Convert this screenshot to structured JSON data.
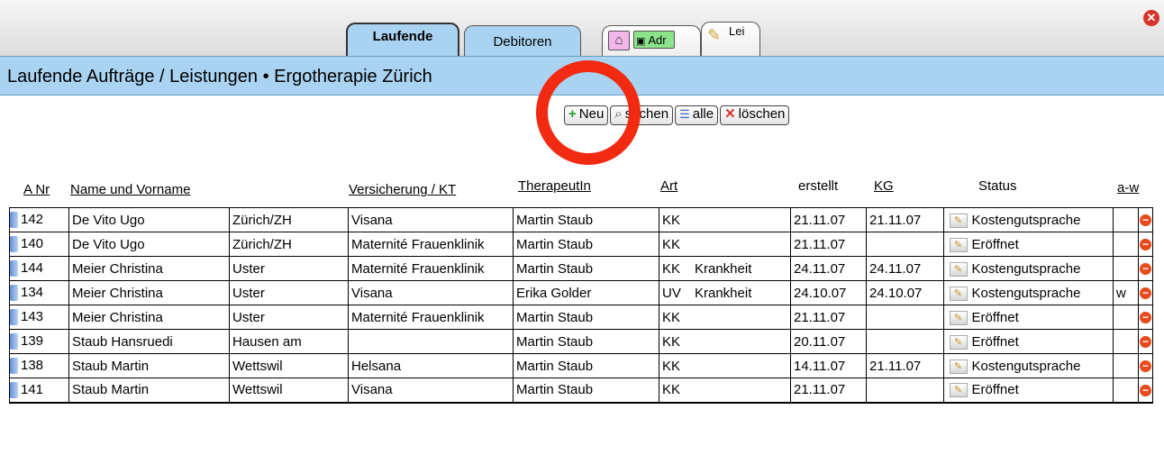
{
  "tabs": {
    "laufende": "Laufende",
    "debitoren": "Debitoren",
    "adr": "Adr",
    "lei": "Lei"
  },
  "title": "Laufende Aufträge / Leistungen • Ergotherapie Zürich",
  "buttons": {
    "neu": "Neu",
    "suchen": "suchen",
    "alle": "alle",
    "loeschen": "löschen"
  },
  "columns": {
    "a_nr": "A Nr",
    "name": "Name und Vorname",
    "versicherung": "Versicherung / KT",
    "therapeut": "TherapeutIn",
    "art": "Art",
    "erstellt": "erstellt",
    "kg": "KG",
    "status": "Status",
    "aw": "a-w"
  },
  "rows": [
    {
      "nr": "142",
      "name": "De Vito Ugo",
      "ort": "Zürich/ZH",
      "vers": "Visana",
      "ther": "Martin Staub",
      "art": "KK",
      "grund": "",
      "erstellt": "21.11.07",
      "kg": "21.11.07",
      "status": "Kostengutsprache",
      "aw": ""
    },
    {
      "nr": "140",
      "name": "De Vito Ugo",
      "ort": "Zürich/ZH",
      "vers": "Maternité Frauenklinik",
      "ther": "Martin Staub",
      "art": "KK",
      "grund": "",
      "erstellt": "21.11.07",
      "kg": "",
      "status": "Eröffnet",
      "aw": ""
    },
    {
      "nr": "144",
      "name": "Meier Christina",
      "ort": "Uster",
      "vers": "Maternité Frauenklinik",
      "ther": "Martin Staub",
      "art": "KK",
      "grund": "Krankheit",
      "erstellt": "24.11.07",
      "kg": "24.11.07",
      "status": "Kostengutsprache",
      "aw": ""
    },
    {
      "nr": "134",
      "name": "Meier Christina",
      "ort": "Uster",
      "vers": "Visana",
      "ther": "Erika Golder",
      "art": "UV",
      "grund": "Krankheit",
      "erstellt": "24.10.07",
      "kg": "24.10.07",
      "status": "Kostengutsprache",
      "aw": "w"
    },
    {
      "nr": "143",
      "name": "Meier Christina",
      "ort": "Uster",
      "vers": "Maternité Frauenklinik",
      "ther": "Martin Staub",
      "art": "KK",
      "grund": "",
      "erstellt": "21.11.07",
      "kg": "",
      "status": "Eröffnet",
      "aw": ""
    },
    {
      "nr": "139",
      "name": "Staub Hansruedi",
      "ort": "Hausen am",
      "vers": "",
      "ther": "Martin Staub",
      "art": "KK",
      "grund": "",
      "erstellt": "20.11.07",
      "kg": "",
      "status": "Eröffnet",
      "aw": ""
    },
    {
      "nr": "138",
      "name": "Staub Martin",
      "ort": "Wettswil",
      "vers": "Helsana",
      "ther": "Martin Staub",
      "art": "KK",
      "grund": "",
      "erstellt": "14.11.07",
      "kg": "21.11.07",
      "status": "Kostengutsprache",
      "aw": ""
    },
    {
      "nr": "141",
      "name": "Staub Martin",
      "ort": "Wettswil",
      "vers": "Visana",
      "ther": "Martin Staub",
      "art": "KK",
      "grund": "",
      "erstellt": "21.11.07",
      "kg": "",
      "status": "Eröffnet",
      "aw": ""
    }
  ],
  "icons": {
    "close": "close-icon",
    "home": "home-icon",
    "address_card": "address-card-icon",
    "pencil": "pencil-icon",
    "plus": "plus-icon",
    "search": "search-icon",
    "list": "list-icon",
    "delete": "delete-icon",
    "edit": "edit-icon",
    "remove": "remove-icon"
  },
  "colors": {
    "accent_blue": "#a9d3f1",
    "highlight_circle": "#f22a12",
    "delete_red": "#d9332b",
    "add_green": "#1f9b28"
  }
}
